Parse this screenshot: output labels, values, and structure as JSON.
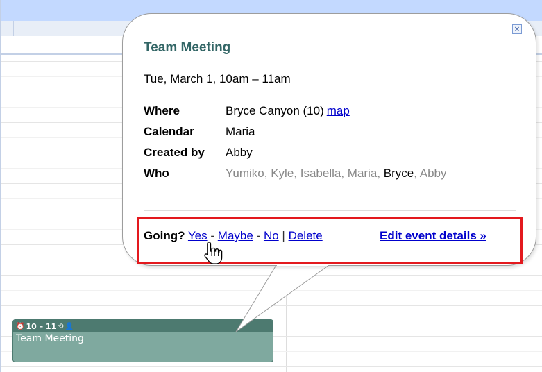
{
  "popup": {
    "title": "Team Meeting",
    "when": "Tue, March 1, 10am – 11am",
    "close_icon": "close-icon",
    "details": [
      {
        "label": "Where",
        "value": "Bryce Canyon (10)",
        "link": "map"
      },
      {
        "label": "Calendar",
        "value": "Maria"
      },
      {
        "label": "Created by",
        "value": "Abby"
      },
      {
        "label": "Who",
        "guests": [
          "Yumiko",
          "Kyle",
          "Isabella",
          "Maria",
          "Bryce",
          "Abby"
        ]
      }
    ],
    "actions": {
      "going_label": "Going?",
      "yes": "Yes",
      "maybe": "Maybe",
      "no": "No",
      "delete": "Delete",
      "dash": "-",
      "pipe": "|",
      "edit_details": "Edit event details »"
    }
  },
  "event_block": {
    "time": "10 – 11",
    "title": "Team Meeting",
    "icons": [
      "reminder-icon",
      "repeat-icon",
      "guests-icon"
    ]
  },
  "colors": {
    "header_band": "#c3d9ff",
    "event_body": "#7fa99f",
    "event_header": "#4d7a70",
    "popup_title": "#336666",
    "link": "#0000cc",
    "highlight_box": "#e3191e",
    "guest_pending": "#888888"
  }
}
